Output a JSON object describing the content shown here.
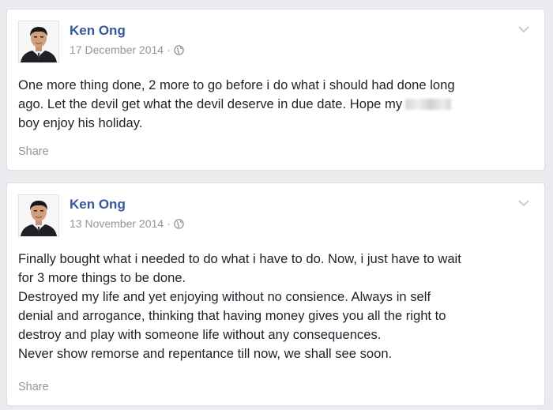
{
  "posts": [
    {
      "author": "Ken Ong",
      "date": "17 December 2014",
      "separator": "·",
      "privacy_icon": "globe-icon",
      "menu_icon": "chevron-down-icon",
      "lines": [
        "One more thing done, 2 more to go before i do what i should had done long",
        "ago. Let the devil get what the devil deserve in due date. Hope my",
        "boy enjoy his holiday."
      ],
      "share_label": "Share"
    },
    {
      "author": "Ken Ong",
      "date": "13 November 2014",
      "separator": "·",
      "privacy_icon": "globe-icon",
      "menu_icon": "chevron-down-icon",
      "lines": [
        "Finally bought what i needed to do what i have to do. Now, i just have to wait",
        "for 3 more things to be done.",
        "Destroyed my life and yet enjoying without no consience. Always in self",
        "denial and arrogance, thinking that having money gives you all the right to",
        "destroy and play with someone life without any consequences.",
        "Never show remorse and repentance till now, we shall see soon."
      ],
      "share_label": "Share"
    }
  ],
  "colors": {
    "background": "#e9ebee",
    "author": "#365899",
    "meta": "#90949c",
    "text": "#1d2129"
  }
}
